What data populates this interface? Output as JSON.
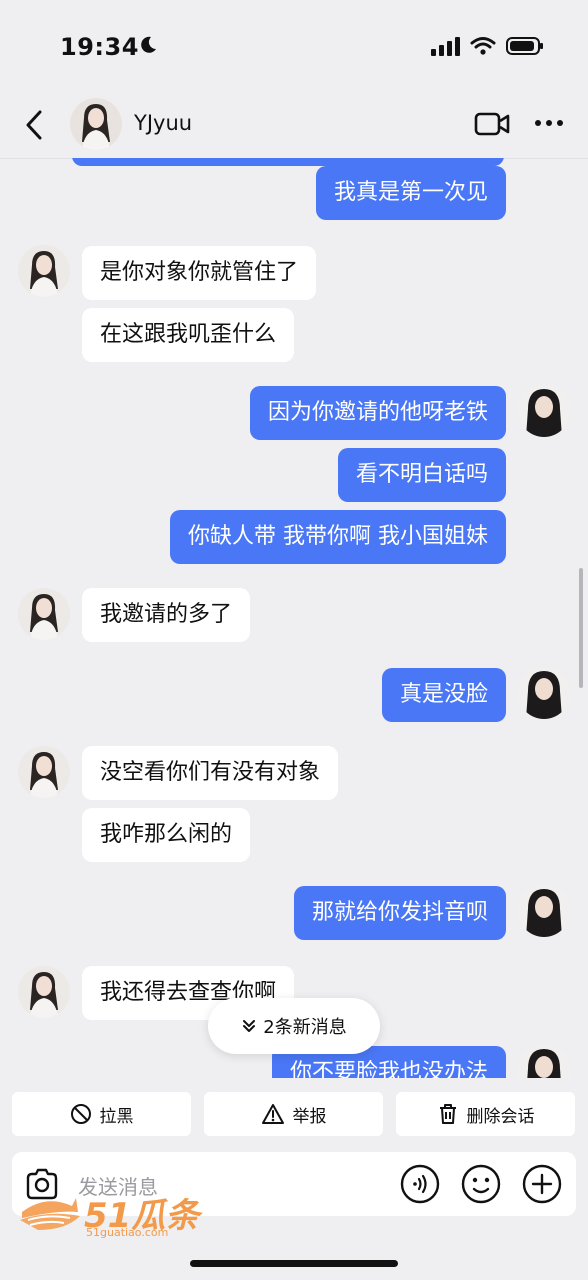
{
  "status": {
    "time": "19:34"
  },
  "header": {
    "name": "YJyuu"
  },
  "messages": [
    {
      "side": "out",
      "text": "我真是第一次见",
      "avatar": false
    },
    {
      "side": "in",
      "text": "是你对象你就管住了",
      "avatar": true
    },
    {
      "side": "in",
      "text": "在这跟我叽歪什么",
      "avatar": false
    },
    {
      "side": "out",
      "text": "因为你邀请的他呀老铁",
      "avatar": true
    },
    {
      "side": "out",
      "text": "看不明白话吗",
      "avatar": false
    },
    {
      "side": "out",
      "text": "你缺人带 我带你啊 我小国姐妹",
      "avatar": false
    },
    {
      "side": "in",
      "text": "我邀请的多了",
      "avatar": true
    },
    {
      "side": "out",
      "text": "真是没脸",
      "avatar": true
    },
    {
      "side": "in",
      "text": "没空看你们有没有对象",
      "avatar": true
    },
    {
      "side": "in",
      "text": "我咋那么闲的",
      "avatar": false
    },
    {
      "side": "out",
      "text": "那就给你发抖音呗",
      "avatar": true
    },
    {
      "side": "in",
      "text": "我还得去查查你啊",
      "avatar": true
    },
    {
      "side": "out",
      "text": "你不要脸我也没办法",
      "avatar": true
    }
  ],
  "new_messages": {
    "label": "2条新消息"
  },
  "actions": {
    "block": "拉黑",
    "report": "举报",
    "delete": "删除会话"
  },
  "input": {
    "placeholder": "发送消息"
  },
  "watermark": {
    "brand": "51瓜条",
    "site": "51guatiao.com"
  }
}
